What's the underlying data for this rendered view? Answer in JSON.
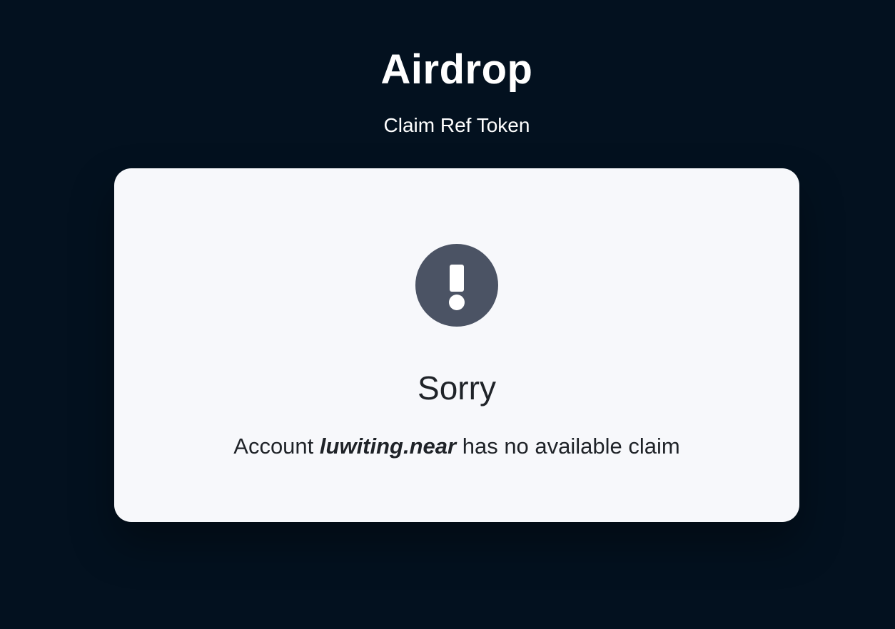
{
  "header": {
    "title": "Airdrop",
    "subtitle": "Claim Ref Token"
  },
  "card": {
    "icon": "exclamation-circle-icon",
    "heading": "Sorry",
    "message_prefix": "Account",
    "account_name": "luwiting.near",
    "message_suffix": "has no available claim"
  },
  "colors": {
    "background": "#03111f",
    "card_background": "#f7f8fb",
    "icon_circle": "#4b5364",
    "text_dark": "#1f2328",
    "text_light": "#ffffff"
  }
}
